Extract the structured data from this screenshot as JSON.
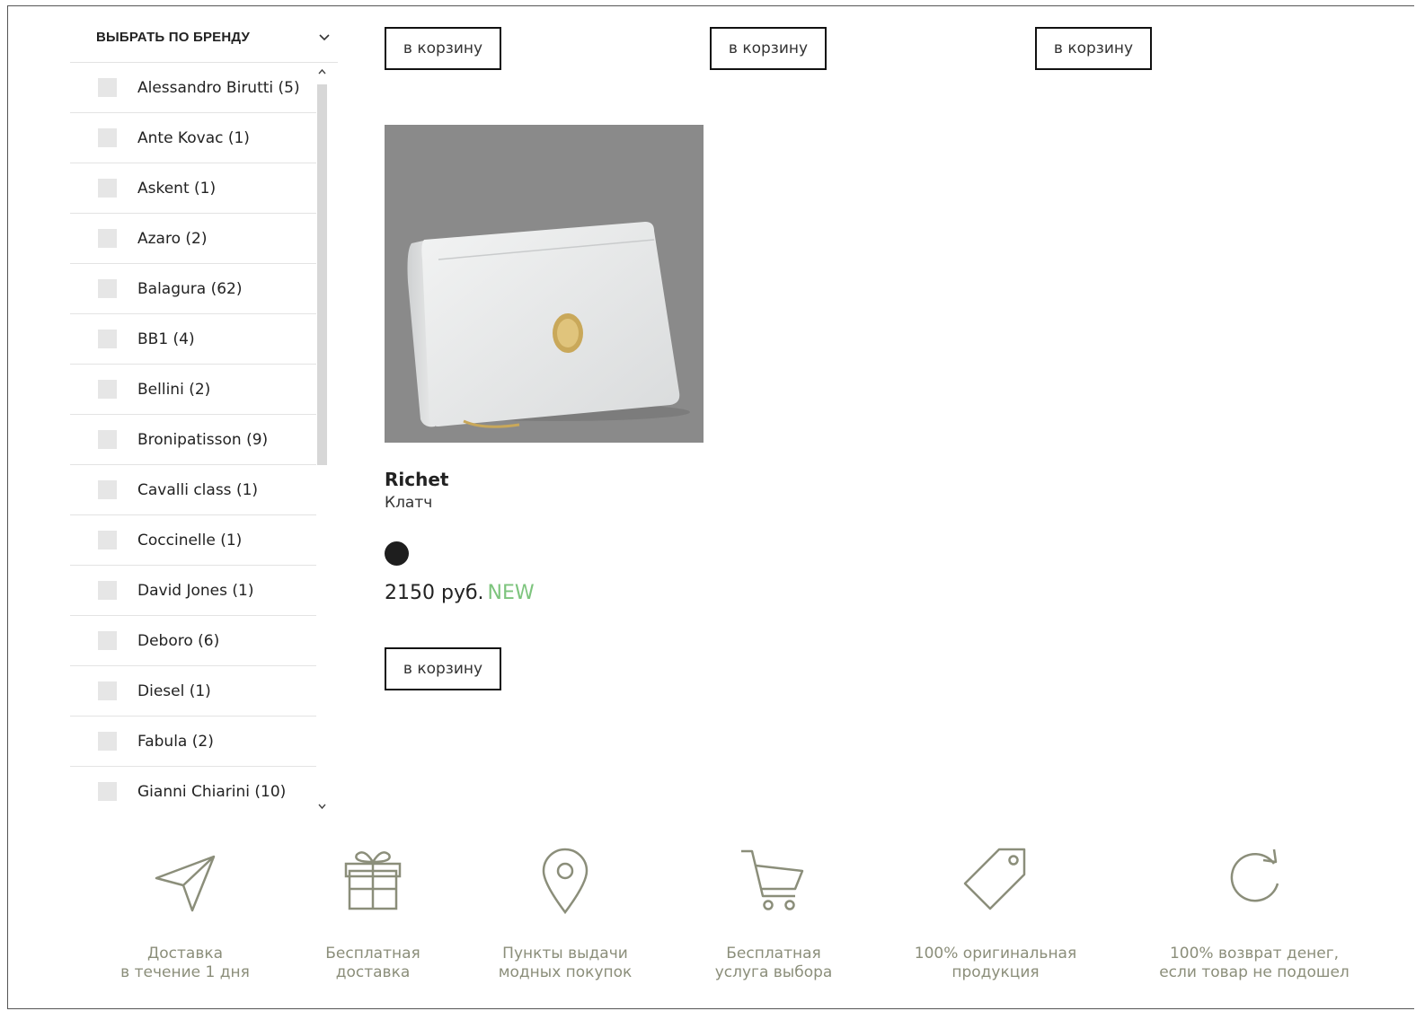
{
  "filter": {
    "title": "ВЫБРАТЬ ПО БРЕНДУ",
    "brands": [
      "Alessandro Birutti (5)",
      "Ante Kovac (1)",
      "Askent (1)",
      "Azaro (2)",
      "Balagura (62)",
      "BB1 (4)",
      "Bellini (2)",
      "Bronipatisson (9)",
      "Cavalli class (1)",
      "Coccinelle (1)",
      "David Jones (1)",
      "Deboro (6)",
      "Diesel (1)",
      "Fabula (2)",
      "Gianni Chiarini (10)"
    ]
  },
  "cart_label": "в корзину",
  "product": {
    "brand": "Richet",
    "type": "Клатч",
    "price": "2150 руб.",
    "badge": "NEW",
    "color_swatch": "#1e1e1e"
  },
  "features": [
    {
      "icon": "paper-plane-icon",
      "line1": "Доставка",
      "line2": "в течение 1 дня"
    },
    {
      "icon": "gift-icon",
      "line1": "Бесплатная",
      "line2": "доставка"
    },
    {
      "icon": "map-pin-icon",
      "line1": "Пункты выдачи",
      "line2": "модных покупок"
    },
    {
      "icon": "shopping-cart-icon",
      "line1": "Бесплатная",
      "line2": "услуга выбора"
    },
    {
      "icon": "price-tag-icon",
      "line1": "100% оригинальная",
      "line2": "продукция"
    },
    {
      "icon": "refresh-icon",
      "line1": "100% возврат денег,",
      "line2": "если товар не подошел"
    }
  ],
  "colors": {
    "accent_new": "#7dc47d",
    "icon_gray": "#8b8e7a"
  }
}
